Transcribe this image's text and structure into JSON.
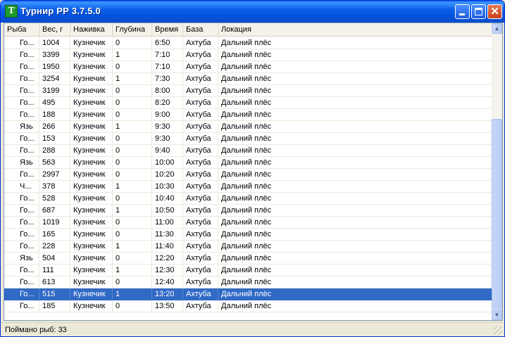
{
  "window": {
    "title": "Турнир РР 3.7.5.0",
    "icon_letter": "T",
    "close_glyph": "✕"
  },
  "table": {
    "columns": [
      "Рыба",
      "Вес, г",
      "Наживка",
      "Глубина",
      "Время",
      "База",
      "Локация"
    ],
    "rows": [
      [
        "Го...",
        "1004",
        "Кузнечик",
        "0",
        "6:50",
        "Ахтуба",
        "Дальний плёс"
      ],
      [
        "Го...",
        "3399",
        "Кузнечик",
        "1",
        "7:10",
        "Ахтуба",
        "Дальний плёс"
      ],
      [
        "Го...",
        "1950",
        "Кузнечик",
        "0",
        "7:10",
        "Ахтуба",
        "Дальний плёс"
      ],
      [
        "Го...",
        "3254",
        "Кузнечик",
        "1",
        "7:30",
        "Ахтуба",
        "Дальний плёс"
      ],
      [
        "Го...",
        "3199",
        "Кузнечик",
        "0",
        "8:00",
        "Ахтуба",
        "Дальний плёс"
      ],
      [
        "Го...",
        "495",
        "Кузнечик",
        "0",
        "8:20",
        "Ахтуба",
        "Дальний плёс"
      ],
      [
        "Го...",
        "188",
        "Кузнечик",
        "0",
        "9:00",
        "Ахтуба",
        "Дальний плёс"
      ],
      [
        "Язь",
        "266",
        "Кузнечик",
        "1",
        "9:30",
        "Ахтуба",
        "Дальний плёс"
      ],
      [
        "Го...",
        "153",
        "Кузнечик",
        "0",
        "9:30",
        "Ахтуба",
        "Дальний плёс"
      ],
      [
        "Го...",
        "288",
        "Кузнечик",
        "0",
        "9:40",
        "Ахтуба",
        "Дальний плёс"
      ],
      [
        "Язь",
        "563",
        "Кузнечик",
        "0",
        "10:00",
        "Ахтуба",
        "Дальний плёс"
      ],
      [
        "Го...",
        "2997",
        "Кузнечик",
        "0",
        "10:20",
        "Ахтуба",
        "Дальний плёс"
      ],
      [
        "Ч...",
        "378",
        "Кузнечик",
        "1",
        "10:30",
        "Ахтуба",
        "Дальний плёс"
      ],
      [
        "Го...",
        "528",
        "Кузнечик",
        "0",
        "10:40",
        "Ахтуба",
        "Дальний плёс"
      ],
      [
        "Го...",
        "687",
        "Кузнечик",
        "1",
        "10:50",
        "Ахтуба",
        "Дальний плёс"
      ],
      [
        "Го...",
        "1019",
        "Кузнечик",
        "0",
        "11:00",
        "Ахтуба",
        "Дальний плёс"
      ],
      [
        "Го...",
        "165",
        "Кузнечик",
        "0",
        "11:30",
        "Ахтуба",
        "Дальний плёс"
      ],
      [
        "Го...",
        "228",
        "Кузнечик",
        "1",
        "11:40",
        "Ахтуба",
        "Дальний плёс"
      ],
      [
        "Язь",
        "504",
        "Кузнечик",
        "0",
        "12:20",
        "Ахтуба",
        "Дальний плёс"
      ],
      [
        "Го...",
        "111",
        "Кузнечик",
        "1",
        "12:30",
        "Ахтуба",
        "Дальний плёс"
      ],
      [
        "Го...",
        "613",
        "Кузнечик",
        "0",
        "12:40",
        "Ахтуба",
        "Дальний плёс"
      ],
      [
        "Го...",
        "515",
        "Кузнечик",
        "1",
        "13:20",
        "Ахтуба",
        "Дальний плёс"
      ],
      [
        "Го...",
        "185",
        "Кузнечик",
        "0",
        "13:50",
        "Ахтуба",
        "Дальний плёс"
      ]
    ],
    "selected_index": 21
  },
  "scrollbar": {
    "up_glyph": "▲",
    "down_glyph": "▼"
  },
  "status": {
    "text": "Поймано рыб: 33"
  },
  "colors": {
    "selection": "#316AC5",
    "titlebar": "#0A5FE6"
  }
}
